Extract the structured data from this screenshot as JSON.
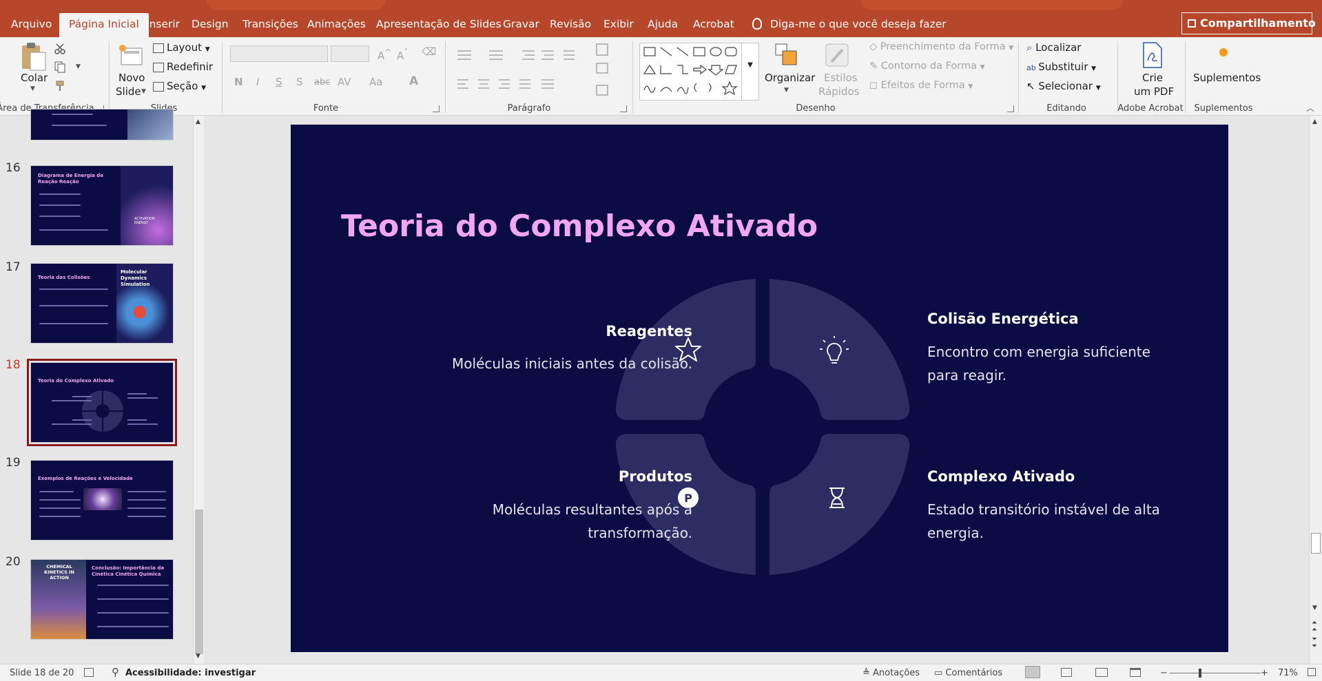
{
  "ribbon_tabs": [
    "Arquivo",
    "Página Inicial",
    "Inserir",
    "Design",
    "Transições",
    "Animações",
    "Apresentação de Slides",
    "Gravar",
    "Revisão",
    "Exibir",
    "Ajuda",
    "Acrobat"
  ],
  "active_tab": "Página Inicial",
  "tell_me": "Diga-me o que você deseja fazer",
  "share_label": "Compartilhamento",
  "groups": {
    "clipboard": {
      "label": "Área de Transferência",
      "paste": "Colar"
    },
    "slides": {
      "label": "Slides",
      "new_slide_1": "Novo",
      "new_slide_2": "Slide",
      "layout": "Layout",
      "reset": "Redefinir",
      "section": "Seção"
    },
    "font": {
      "label": "Fonte",
      "bold": "N",
      "italic": "I",
      "underline": "S",
      "shadow": "S",
      "strike": "abc",
      "spacing": "AV",
      "case": "Aa"
    },
    "paragraph": {
      "label": "Parágrafo"
    },
    "drawing": {
      "label": "Desenho",
      "arrange": "Organizar",
      "quick_styles_1": "Estilos",
      "quick_styles_2": "Rápidos",
      "fill": "Preenchimento da Forma",
      "outline": "Contorno da Forma",
      "effects": "Efeitos de Forma"
    },
    "editing": {
      "label": "Editando",
      "find": "Localizar",
      "replace": "Substituir",
      "select": "Selecionar"
    },
    "acrobat": {
      "label": "Adobe Acrobat",
      "create_1": "Crie",
      "create_2": "um PDF"
    },
    "addins": {
      "label": "Suplementos",
      "button": "Suplementos"
    }
  },
  "thumbnails": [
    {
      "num": "16",
      "title": "Diagrama de Energia de Reação Reação",
      "side_text": "ACTIVATION ENERGY"
    },
    {
      "num": "17",
      "title": "Teoria das Colisões",
      "side_text": "Molecular Dynamics Simulation"
    },
    {
      "num": "18",
      "title": "Teoria do Complexo Ativado",
      "side_text": ""
    },
    {
      "num": "19",
      "title": "Exemplos de Reações e Velocidade",
      "side_text": ""
    },
    {
      "num": "20",
      "title": "Conclusão: Importância da Cinética Cinética Química",
      "side_text": "CHEMICAL KINETICS IN ACTION"
    }
  ],
  "active_slide": "18",
  "slide": {
    "title": "Teoria do Complexo Ativado",
    "items": [
      {
        "heading": "Reagentes",
        "text": "Moléculas iniciais antes da colisão.",
        "icon": "star-icon"
      },
      {
        "heading": "Colisão Energética",
        "text": "Encontro com energia suficiente para reagir.",
        "icon": "lightbulb-icon"
      },
      {
        "heading": "Produtos",
        "text": "Moléculas resultantes após a transformação.",
        "icon": "product-p-icon"
      },
      {
        "heading": "Complexo Ativado",
        "text": "Estado transitório instável de alta energia.",
        "icon": "hourglass-icon"
      }
    ]
  },
  "status": {
    "slide_count": "Slide 18 de 20",
    "accessibility": "Acessibilidade: investigar",
    "notes": "Anotações",
    "comments": "Comentários",
    "zoom": "71%"
  },
  "colors": {
    "ribbon_accent": "#b7472a",
    "slide_bg": "#0c0c45",
    "title_pink": "#f0a6f0",
    "quadrant_fill": "#2d2d63"
  }
}
